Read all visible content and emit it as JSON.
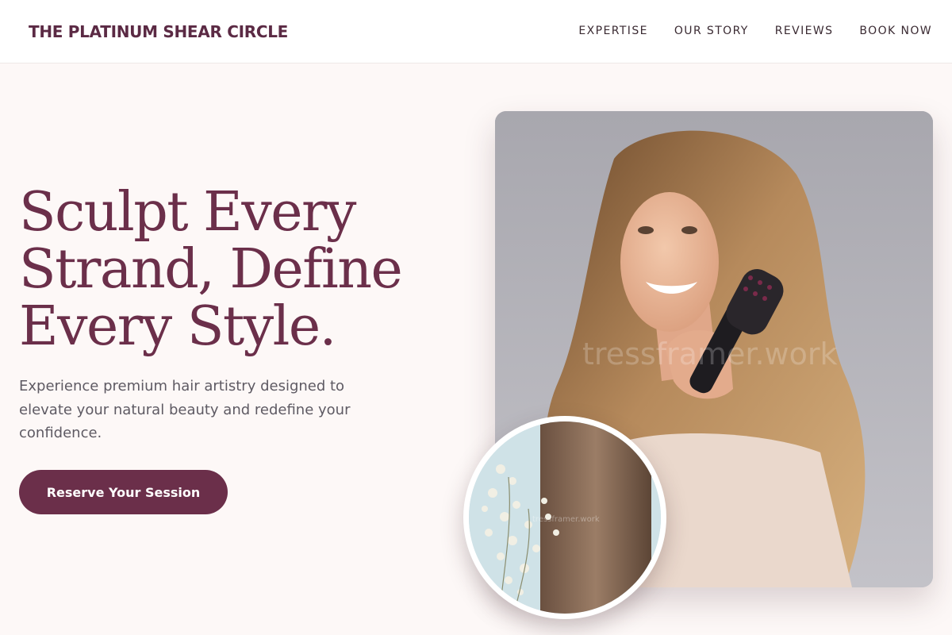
{
  "header": {
    "brand": "THE PLATINUM SHEAR CIRCLE",
    "nav": [
      "EXPERTISE",
      "OUR STORY",
      "REVIEWS",
      "BOOK NOW"
    ]
  },
  "hero": {
    "title_lines": [
      "Sculpt Every",
      "Strand, Define",
      "Every Style."
    ],
    "subtitle": "Experience premium hair artistry designed to elevate your natural beauty and redefine your confidence.",
    "cta_label": "Reserve Your Session",
    "main_image": {
      "alt": "Smiling woman with long wavy blonde hair holding a hair styling brush",
      "watermark": "tressframer.work"
    },
    "inset_image": {
      "alt": "Straight brown hair beside a sprig of baby's breath flowers",
      "watermark": "tressframer.work"
    }
  },
  "colors": {
    "accent": "#6b2f4a",
    "page_background": "#fdf8f7",
    "header_background": "#ffffff",
    "body_text": "#5e5a63"
  }
}
